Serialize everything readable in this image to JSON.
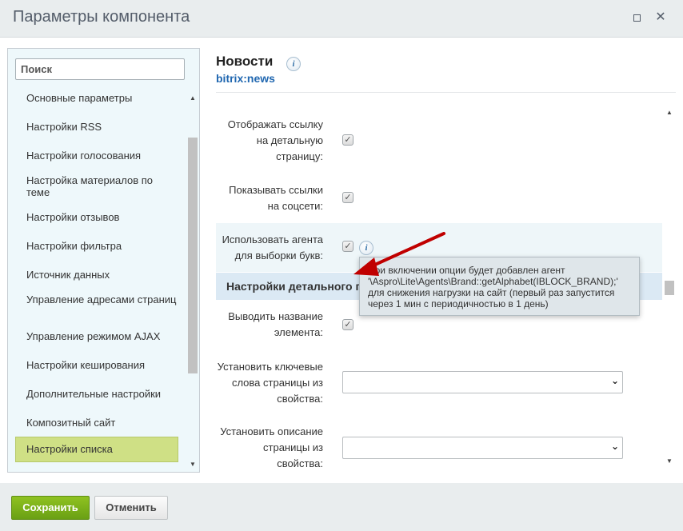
{
  "window": {
    "title": "Параметры компонента"
  },
  "sidebar": {
    "search_placeholder": "Поиск",
    "items": [
      {
        "label": "Основные параметры"
      },
      {
        "label": "Настройки RSS"
      },
      {
        "label": "Настройки голосования"
      },
      {
        "label": "Настройка материалов по теме"
      },
      {
        "label": "Настройки отзывов"
      },
      {
        "label": "Настройки фильтра"
      },
      {
        "label": "Источник данных"
      },
      {
        "label": "Управление адресами страниц"
      },
      {
        "label": "Управление режимом AJAX"
      },
      {
        "label": "Настройки кеширования"
      },
      {
        "label": "Дополнительные настройки"
      },
      {
        "label": "Композитный сайт"
      },
      {
        "label": "Настройки списка",
        "active": true
      }
    ]
  },
  "component": {
    "name": "Новости",
    "code": "bitrix:news"
  },
  "params": [
    {
      "label": "Отображать ссылку на детальную страницу:",
      "type": "checkbox",
      "checked": true
    },
    {
      "label": "Показывать ссылки на соцсети:",
      "type": "checkbox",
      "checked": true
    },
    {
      "label": "Использовать агента для выборки букв:",
      "type": "checkbox",
      "checked": true
    }
  ],
  "section": {
    "title": "Настройки детального п"
  },
  "params2": [
    {
      "label": "Выводить название элемента:",
      "type": "checkbox",
      "checked": true
    },
    {
      "label": "Установить ключевые слова страницы из свойства:",
      "type": "select",
      "value": ""
    },
    {
      "label": "Установить описание страницы из свойства:",
      "type": "select",
      "value": ""
    }
  ],
  "tooltip": {
    "lines": [
      "При включении опции будет добавлен агент",
      "'\\Aspro\\Lite\\Agents\\Brand::getAlphabet(IBLOCK_BRAND);'",
      "для снижения нагрузки на сайт (первый раз запустится",
      "через 1 мин с периодичностью в 1 день)"
    ]
  },
  "footer": {
    "save_label": "Сохранить",
    "cancel_label": "Отменить"
  },
  "colors": {
    "save_button": "#7bb31a",
    "section_bg": "#dbe9f4",
    "active_item_bg": "#cfe085",
    "arrow": "#c00000"
  },
  "icons": {
    "info": "info-icon",
    "check": "check-icon",
    "maximize": "maximize-icon",
    "close": "close-icon",
    "chevron": "chevron-down-icon"
  }
}
